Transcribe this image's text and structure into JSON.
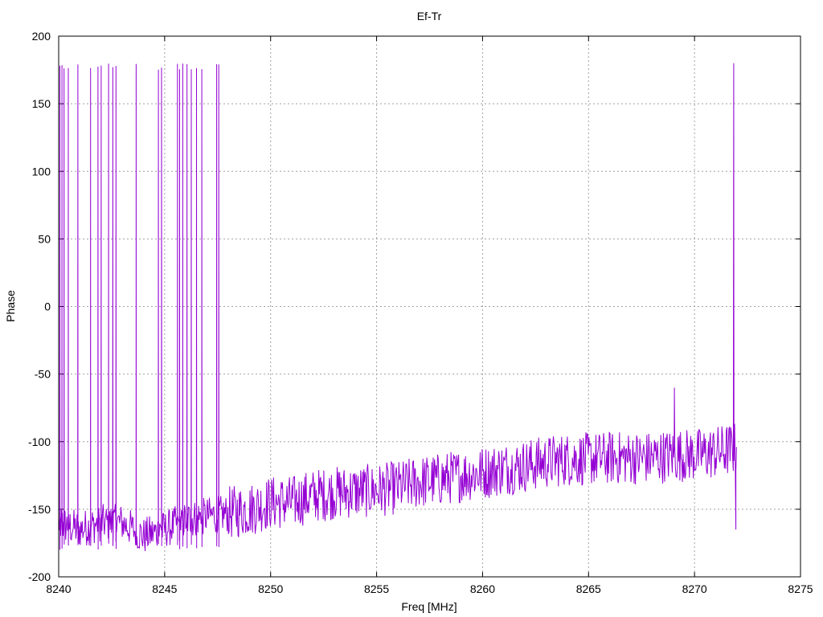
{
  "chart_data": {
    "type": "line",
    "title": "Ef-Tr",
    "xlabel": "Freq [MHz]",
    "ylabel": "Phase",
    "xlim": [
      8240,
      8275
    ],
    "ylim": [
      -200,
      200
    ],
    "xticks": [
      8240,
      8245,
      8250,
      8255,
      8260,
      8265,
      8270,
      8275
    ],
    "yticks": [
      -200,
      -150,
      -100,
      -50,
      0,
      50,
      100,
      150,
      200
    ],
    "grid": true,
    "legend": "none",
    "color": "#9400d3",
    "series": [
      {
        "x_range": [
          8240,
          8272
        ],
        "baseline": [
          [
            8240.0,
            -160
          ],
          [
            8241.0,
            -165
          ],
          [
            8242.0,
            -160
          ],
          [
            8243.0,
            -160
          ],
          [
            8244.0,
            -170
          ],
          [
            8245.0,
            -165
          ],
          [
            8246.0,
            -158
          ],
          [
            8247.0,
            -155
          ],
          [
            8248.0,
            -153
          ],
          [
            8249.0,
            -150
          ],
          [
            8250.0,
            -145
          ],
          [
            8251.0,
            -145
          ],
          [
            8252.0,
            -140
          ],
          [
            8253.0,
            -138
          ],
          [
            8254.0,
            -137
          ],
          [
            8255.0,
            -136
          ],
          [
            8256.0,
            -134
          ],
          [
            8257.0,
            -130
          ],
          [
            8258.0,
            -128
          ],
          [
            8259.0,
            -125
          ],
          [
            8260.0,
            -123
          ],
          [
            8261.0,
            -120
          ],
          [
            8262.0,
            -118
          ],
          [
            8263.0,
            -115
          ],
          [
            8264.0,
            -113
          ],
          [
            8265.0,
            -113
          ],
          [
            8266.0,
            -112
          ],
          [
            8267.0,
            -112
          ],
          [
            8268.0,
            -112
          ],
          [
            8269.0,
            -110
          ],
          [
            8270.0,
            -110
          ],
          [
            8271.0,
            -108
          ],
          [
            8272.0,
            -105
          ]
        ],
        "wrap_spikes": [
          8240.05,
          8240.15,
          8240.25,
          8240.45,
          8240.9,
          8241.5,
          8241.85,
          8242.0,
          8242.35,
          8242.55,
          8242.7,
          8243.65,
          8244.7,
          8244.85,
          8245.6,
          8245.7,
          8245.85,
          8246.05,
          8246.25,
          8246.5,
          8246.75,
          8247.45,
          8247.55
        ],
        "isolated_peaks": [
          [
            8269.05,
            -60
          ],
          [
            8271.85,
            180
          ],
          [
            8271.95,
            -165
          ]
        ]
      }
    ]
  }
}
